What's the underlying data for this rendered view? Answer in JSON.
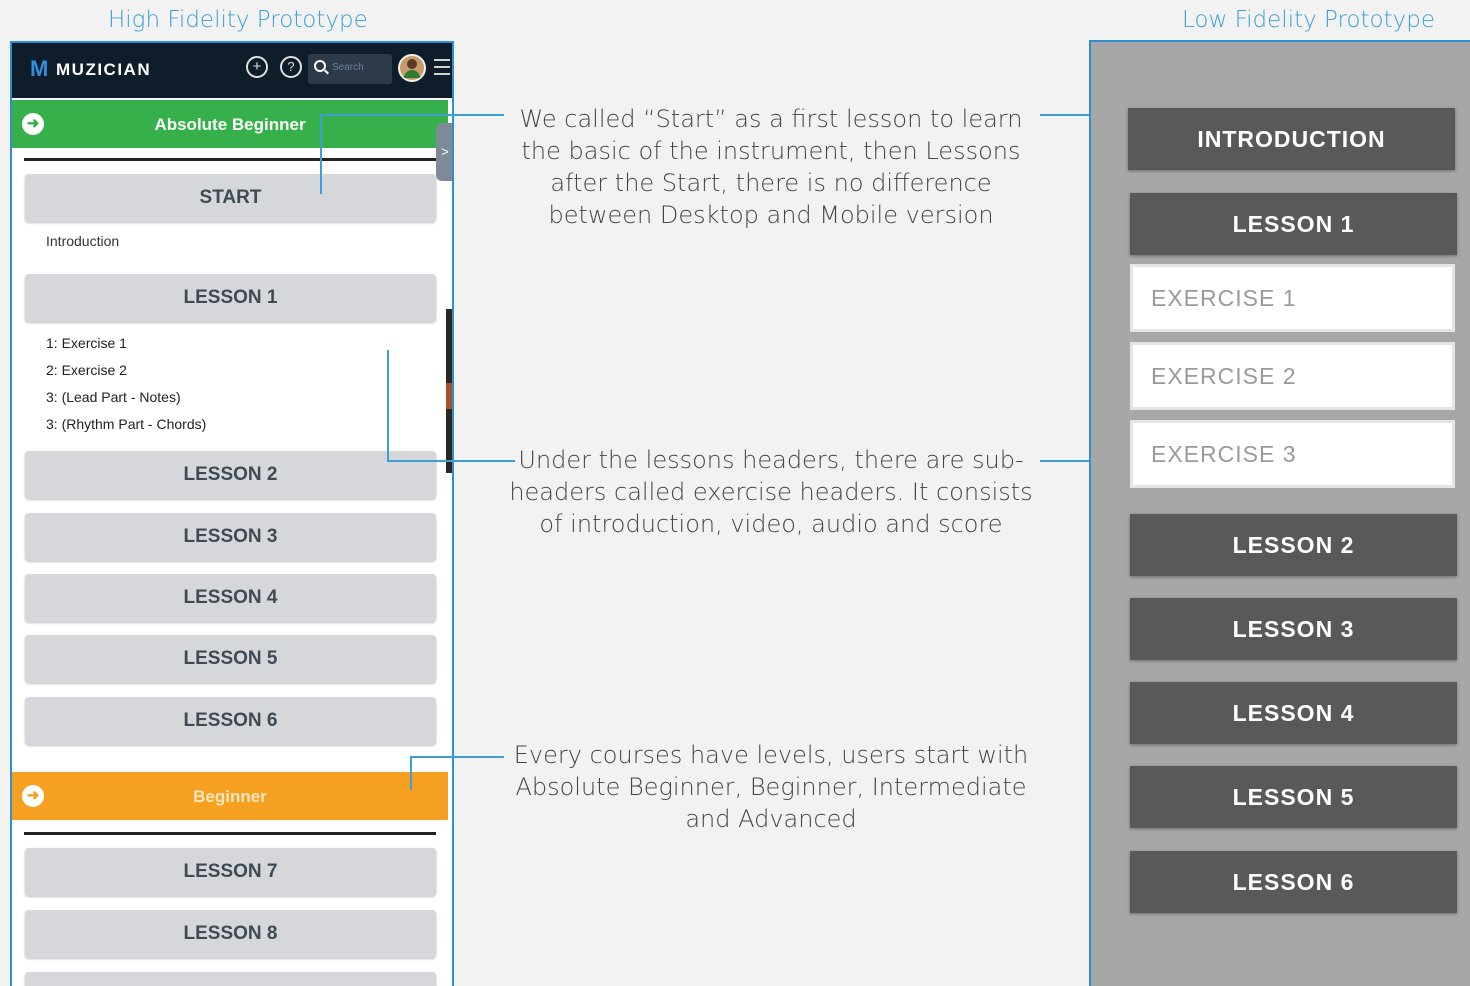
{
  "titles": {
    "high_fidelity": "High Fidelity Prototype",
    "low_fidelity": "Low Fidelity Prototype"
  },
  "app": {
    "logo_mark": "M",
    "logo_text": "MUZICIAN",
    "add_icon_glyph": "+",
    "help_icon_glyph": "?",
    "search_placeholder": "Search",
    "side_tab_glyph": ">"
  },
  "levels": {
    "absolute_beginner": "Absolute Beginner",
    "beginner": "Beginner",
    "arrow_glyph": "➜"
  },
  "hf_lessons": {
    "start": "START",
    "introduction": "Introduction",
    "lesson1": "LESSON 1",
    "exercises": [
      "1: Exercise 1",
      "2: Exercise 2",
      "3: (Lead Part - Notes)",
      "3: (Rhythm Part - Chords)"
    ],
    "lesson2": "LESSON 2",
    "lesson3": "LESSON 3",
    "lesson4": "LESSON 4",
    "lesson5": "LESSON 5",
    "lesson6": "LESSON 6",
    "lesson7": "LESSON 7",
    "lesson8": "LESSON 8"
  },
  "annotations": {
    "start_note": "We called “Start” as a first lesson to learn the basic of the instrument, then Lessons after the Start, there is no difference between Desktop and Mobile version",
    "exercise_note": "Under the lessons headers, there are sub-headers called exercise headers. It consists of introduction, video, audio and score",
    "levels_note": "Every courses have levels, users start with Absolute Beginner, Beginner, Intermediate and Advanced"
  },
  "low_fidelity": {
    "introduction": "INTRODUCTION",
    "lesson1": "LESSON 1",
    "exercise1": "EXERCISE 1",
    "exercise2": "EXERCISE 2",
    "exercise3": "EXERCISE 3",
    "lesson2": "LESSON 2",
    "lesson3": "LESSON 3",
    "lesson4": "LESSON 4",
    "lesson5": "LESSON 5",
    "lesson6": "LESSON 6"
  },
  "colors": {
    "accent_blue": "#3d9fd6",
    "level_green": "#35b04b",
    "level_orange": "#f6a022",
    "app_bar": "#0f1c2a"
  }
}
